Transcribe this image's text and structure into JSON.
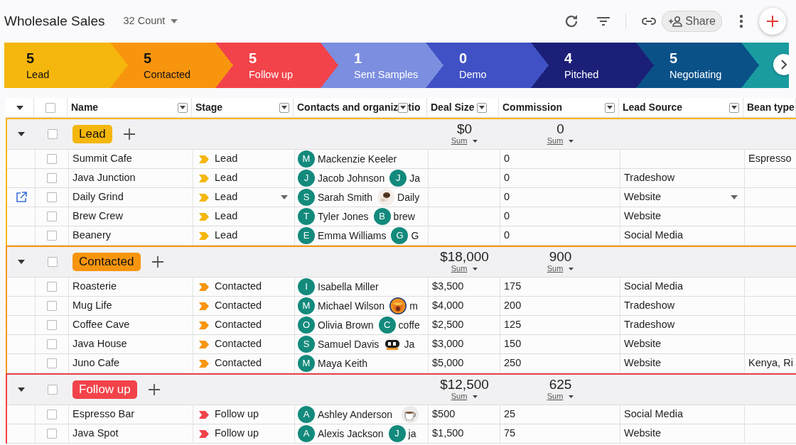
{
  "header": {
    "title": "Wholesale Sales",
    "count": "32 Count"
  },
  "toolbar": {
    "share_label": "Share"
  },
  "pipeline": [
    {
      "count": "5",
      "label": "Lead",
      "color": "#f5b60d"
    },
    {
      "count": "5",
      "label": "Contacted",
      "color": "#f8950f"
    },
    {
      "count": "5",
      "label": "Follow up",
      "color": "#f2434a"
    },
    {
      "count": "1",
      "label": "Sent Samples",
      "color": "#7b8ee0"
    },
    {
      "count": "0",
      "label": "Demo",
      "color": "#3f51c4"
    },
    {
      "count": "4",
      "label": "Pitched",
      "color": "#1b1f78"
    },
    {
      "count": "5",
      "label": "Negotiating",
      "color": "#0a5188"
    },
    {
      "color": "#1a9ba0"
    }
  ],
  "columns": [
    {
      "label": "Name",
      "filter": true
    },
    {
      "label": "Stage",
      "filter": true
    },
    {
      "label": "Contacts and organiz",
      "label_after_filter": "tio",
      "filter": true
    },
    {
      "label": "Deal Size",
      "filter": true
    },
    {
      "label": "Commission",
      "filter": true
    },
    {
      "label": "Lead Source",
      "filter": true
    },
    {
      "label": "Bean type",
      "filter": false
    }
  ],
  "header_checked": false,
  "groups": [
    {
      "label": "Lead",
      "color": "#f5b60d",
      "expanded": true,
      "checked": false,
      "deal_sum": "$0",
      "deal_sum_label": "Sum",
      "commission_sum": "0",
      "commission_sum_label": "Sum",
      "rows": [
        {
          "name": "Summit Cafe",
          "checked": false,
          "hovered": false,
          "stage": "Lead",
          "contacts": [
            {
              "kind": "avatar",
              "initial": "M",
              "text": "Mackenzie Keeler"
            }
          ],
          "commission": "0",
          "bean_type": "Espresso"
        },
        {
          "name": "Java Junction",
          "checked": false,
          "hovered": false,
          "stage": "Lead",
          "contacts": [
            {
              "kind": "avatar",
              "initial": "J",
              "text": "Jacob Johnson"
            },
            {
              "kind": "avatar",
              "initial": "J",
              "text": "Ja"
            }
          ],
          "commission": "0",
          "lead_source": "Tradeshow"
        },
        {
          "name": "Daily Grind",
          "checked": false,
          "hovered": true,
          "stage": "Lead",
          "contacts": [
            {
              "kind": "avatar",
              "initial": "S",
              "text": "Sarah Smith"
            },
            {
              "kind": "picture",
              "text": "Daily"
            }
          ],
          "commission": "0",
          "lead_source": "Website"
        },
        {
          "name": "Brew Crew",
          "checked": false,
          "hovered": false,
          "stage": "Lead",
          "contacts": [
            {
              "kind": "avatar",
              "initial": "T",
              "text": "Tyler Jones"
            },
            {
              "kind": "avatar",
              "initial": "B",
              "text": "brew"
            }
          ],
          "commission": "0",
          "lead_source": "Website"
        },
        {
          "name": "Beanery",
          "checked": false,
          "hovered": false,
          "stage": "Lead",
          "contacts": [
            {
              "kind": "avatar",
              "initial": "E",
              "text": "Emma Williams"
            },
            {
              "kind": "avatar",
              "initial": "G",
              "text": "G"
            }
          ],
          "commission": "0",
          "lead_source": "Social Media"
        }
      ]
    },
    {
      "label": "Contacted",
      "color": "#f8950f",
      "expanded": true,
      "checked": false,
      "deal_sum": "$18,000",
      "deal_sum_label": "Sum",
      "commission_sum": "900",
      "commission_sum_label": "Sum",
      "rows": [
        {
          "name": "Roasterie",
          "checked": false,
          "hovered": false,
          "stage": "Contacted",
          "contacts": [
            {
              "kind": "avatar",
              "initial": "I",
              "text": "Isabella Miller"
            }
          ],
          "deal_size": "$3,500",
          "commission": "175",
          "lead_source": "Social Media"
        },
        {
          "name": "Mug Life",
          "checked": false,
          "hovered": false,
          "stage": "Contacted",
          "contacts": [
            {
              "kind": "avatar",
              "initial": "M",
              "text": "Michael Wilson"
            },
            {
              "kind": "picture",
              "text": "m"
            }
          ],
          "deal_size": "$4,000",
          "commission": "200",
          "lead_source": "Tradeshow"
        },
        {
          "name": "Coffee Cave",
          "checked": false,
          "hovered": false,
          "stage": "Contacted",
          "contacts": [
            {
              "kind": "avatar",
              "initial": "O",
              "text": "Olivia Brown"
            },
            {
              "kind": "avatar",
              "initial": "C",
              "text": "coffe"
            }
          ],
          "deal_size": "$2,500",
          "commission": "125",
          "lead_source": "Tradeshow"
        },
        {
          "name": "Java House",
          "checked": false,
          "hovered": false,
          "stage": "Contacted",
          "contacts": [
            {
              "kind": "avatar",
              "initial": "S",
              "text": "Samuel Davis"
            },
            {
              "kind": "picture",
              "text": "Ja"
            }
          ],
          "deal_size": "$3,000",
          "commission": "150",
          "lead_source": "Website"
        },
        {
          "name": "Juno Cafe",
          "checked": false,
          "hovered": false,
          "stage": "Contacted",
          "contacts": [
            {
              "kind": "avatar",
              "initial": "M",
              "text": "Maya Keith"
            }
          ],
          "deal_size": "$5,000",
          "commission": "250",
          "lead_source": "Website",
          "bean_type": "Kenya, Ri"
        }
      ]
    },
    {
      "label": "Follow up",
      "color": "#f2434a",
      "expanded": true,
      "checked": false,
      "deal_sum": "$12,500",
      "deal_sum_label": "Sum",
      "commission_sum": "625",
      "commission_sum_label": "Sum",
      "rows": [
        {
          "name": "Espresso Bar",
          "checked": false,
          "hovered": false,
          "stage": "Follow up",
          "contacts": [
            {
              "kind": "avatar",
              "initial": "A",
              "text": "Ashley Anderson"
            },
            {
              "kind": "picture"
            }
          ],
          "deal_size": "$500",
          "commission": "25",
          "lead_source": "Social Media"
        },
        {
          "name": "Java Spot",
          "checked": false,
          "hovered": false,
          "stage": "Follow up",
          "contacts": [
            {
              "kind": "avatar",
              "initial": "A",
              "text": "Alexis Jackson"
            },
            {
              "kind": "avatar",
              "initial": "J",
              "text": "ja"
            }
          ],
          "deal_size": "$1,500",
          "commission": "75",
          "lead_source": "Website"
        }
      ]
    }
  ]
}
